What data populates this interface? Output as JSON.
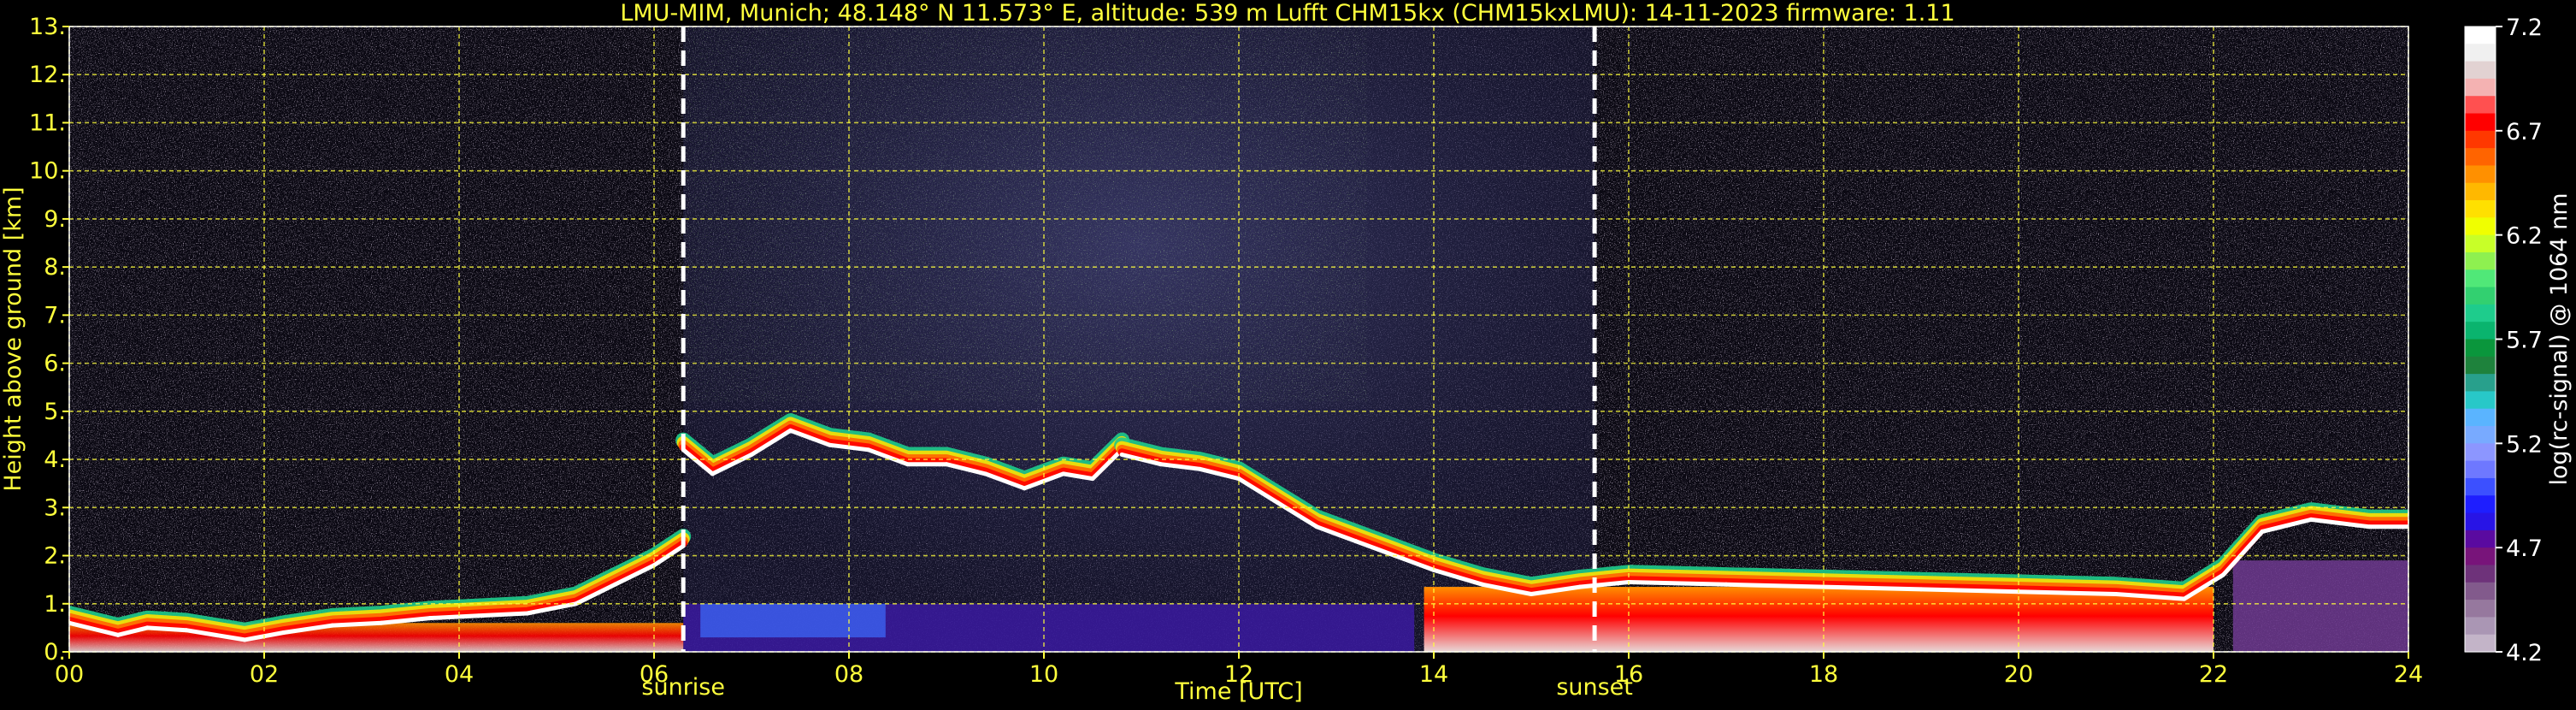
{
  "chart_data": {
    "type": "heatmap",
    "title": "LMU-MIM, Munich; 48.148° N 11.573° E, altitude: 539 m    Lufft CHM15kx (CHM15kxLMU): 14-11-2023    firmware: 1.11",
    "xlabel": "Time [UTC]",
    "ylabel": "Height above ground [km]",
    "xlim": [
      0,
      24
    ],
    "ylim": [
      0,
      13
    ],
    "x_ticks": [
      "00",
      "02",
      "04",
      "06",
      "08",
      "10",
      "12",
      "14",
      "16",
      "18",
      "20",
      "22",
      "24"
    ],
    "y_ticks": [
      "0.",
      "1.",
      "2.",
      "3.",
      "4.",
      "5.",
      "6.",
      "7.",
      "8.",
      "9.",
      "10.",
      "11.",
      "12.",
      "13."
    ],
    "grid": true,
    "colorbar": {
      "label": "log(rc-signal) @ 1064 nm",
      "range": [
        4.2,
        7.2
      ],
      "ticks": [
        "7.2",
        "6.7",
        "6.2",
        "5.7",
        "5.2",
        "4.7",
        "4.2"
      ],
      "colors": [
        "#ffffff",
        "#f0f0f0",
        "#e2d2d2",
        "#f4b2b2",
        "#ff5050",
        "#ff0000",
        "#ff3800",
        "#ff6400",
        "#ff9000",
        "#ffb800",
        "#ffe000",
        "#f0ff00",
        "#c8ff28",
        "#8ef050",
        "#50e878",
        "#32d070",
        "#1ecc8c",
        "#0ab46e",
        "#0a963c",
        "#1e823c",
        "#28a08c",
        "#28c8c8",
        "#5ab4ff",
        "#78aaff",
        "#8c96ff",
        "#6e78ff",
        "#3c50ff",
        "#1e1eff",
        "#2814e6",
        "#5a0aa0",
        "#78147a",
        "#6e327a",
        "#825a8c",
        "#96789e",
        "#aa96b4",
        "#c3b4c8"
      ]
    },
    "markers": [
      {
        "label": "sunrise",
        "x": 6.3
      },
      {
        "label": "sunset",
        "x": 15.65
      }
    ],
    "series": [
      {
        "description_key": "boundary_layer_top",
        "x": [
          0.0,
          0.5,
          0.8,
          1.2,
          1.8,
          2.2,
          2.7,
          3.2,
          3.7,
          4.2,
          4.7,
          5.2,
          5.6,
          6.0,
          6.3
        ],
        "y": [
          0.6,
          0.35,
          0.5,
          0.45,
          0.25,
          0.4,
          0.55,
          0.6,
          0.7,
          0.75,
          0.8,
          1.0,
          1.4,
          1.8,
          2.2
        ]
      },
      {
        "description_key": "morning_cloud_layer",
        "x": [
          6.3,
          6.6,
          7.0,
          7.4,
          7.8,
          8.2,
          8.6,
          9.0,
          9.4,
          9.8,
          10.2,
          10.5,
          10.8
        ],
        "y": [
          4.2,
          3.7,
          4.1,
          4.6,
          4.3,
          4.2,
          3.9,
          3.9,
          3.7,
          3.4,
          3.7,
          3.6,
          4.2
        ]
      },
      {
        "description_key": "afternoon_cloud_layer",
        "x": [
          10.8,
          11.2,
          11.6,
          12.0,
          12.4,
          12.8,
          13.2,
          13.6,
          14.0,
          14.5,
          15.0,
          15.5,
          16.0,
          17.0,
          18.0,
          19.0,
          20.0,
          21.0,
          21.7,
          22.1,
          22.5,
          23.0,
          23.6,
          24.0
        ],
        "y": [
          4.1,
          3.9,
          3.8,
          3.6,
          3.1,
          2.6,
          2.3,
          2.0,
          1.7,
          1.4,
          1.2,
          1.35,
          1.45,
          1.4,
          1.35,
          1.3,
          1.25,
          1.2,
          1.1,
          1.6,
          2.5,
          2.75,
          2.6,
          2.6
        ]
      }
    ]
  }
}
